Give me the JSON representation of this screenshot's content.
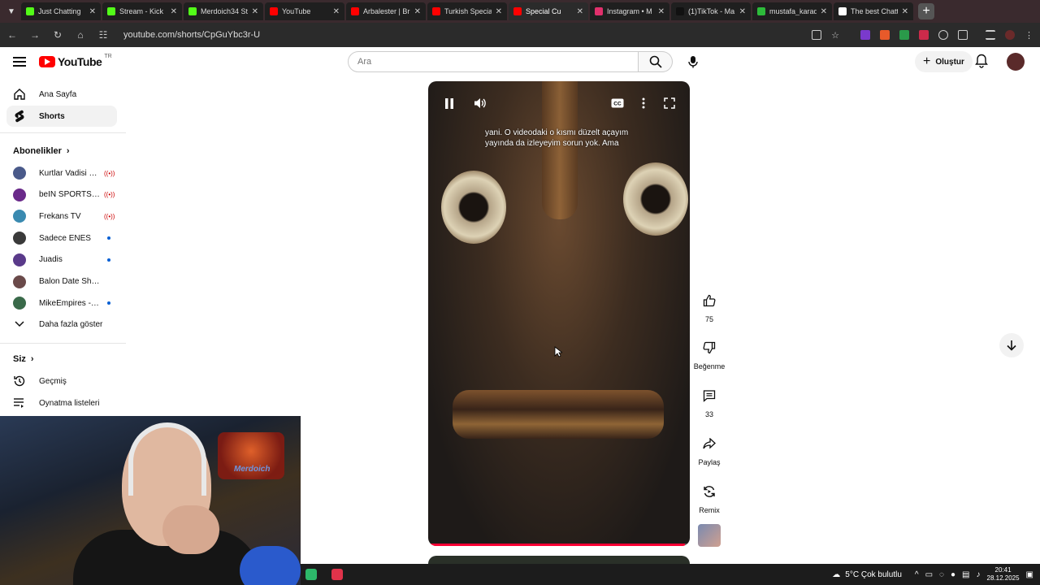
{
  "browser": {
    "tabs": [
      {
        "title": "Just Chatting",
        "color": "#53fc18"
      },
      {
        "title": "Stream - Kick",
        "color": "#53fc18"
      },
      {
        "title": "Merdoich34 St",
        "color": "#53fc18"
      },
      {
        "title": "YouTube",
        "color": "#ff0000"
      },
      {
        "title": "Arbalester | Br",
        "color": "#ff0000"
      },
      {
        "title": "Turkish Special",
        "color": "#ff0000"
      },
      {
        "title": "Special Cu",
        "color": "#ff0000",
        "active": true
      },
      {
        "title": "Instagram • M",
        "color": "#e1306c"
      },
      {
        "title": "(1)TikTok - Ma",
        "color": "#111111"
      },
      {
        "title": "mustafa_karad",
        "color": "#2dbb3a"
      },
      {
        "title": "The best Chatt",
        "color": "#ffffff"
      }
    ],
    "url": "youtube.com/shorts/CpGuYbc3r-U"
  },
  "header": {
    "logo_text": "YouTube",
    "country": "TR",
    "search_placeholder": "Ara",
    "create_label": "Oluştur"
  },
  "sidebar": {
    "main": [
      {
        "label": "Ana Sayfa"
      },
      {
        "label": "Shorts"
      }
    ],
    "subscriptions_heading": "Abonelikler",
    "channels": [
      {
        "name": "Kurtlar Vadisi Pu...",
        "status": "live",
        "color": "#4a5a8a"
      },
      {
        "name": "beIN SPORTS Tü...",
        "status": "live",
        "color": "#6a2a8a"
      },
      {
        "name": "Frekans TV",
        "status": "live",
        "color": "#3a8ab0"
      },
      {
        "name": "Sadece ENES",
        "status": "new",
        "color": "#3a3a3a"
      },
      {
        "name": "Juadis",
        "status": "new",
        "color": "#5a3a8a"
      },
      {
        "name": "Balon Date Show",
        "status": "none",
        "color": "#6a4a4a"
      },
      {
        "name": "MikeEmpires - A...",
        "status": "new",
        "color": "#3a6a4a"
      }
    ],
    "show_more": "Daha fazla göster",
    "you_heading": "Siz",
    "you_items": [
      {
        "label": "Geçmiş"
      },
      {
        "label": "Oynatma listeleri"
      }
    ]
  },
  "webcam": {
    "sign_text": "Merdoich"
  },
  "player": {
    "caption": "yani. O videodaki o kısmı düzelt açayım yayında da izleyeyim sorun yok. Ama",
    "progress": 0.98
  },
  "actions": {
    "like_count": "75",
    "dislike_label": "Beğenme",
    "comment_count": "33",
    "share_label": "Paylaş",
    "remix_label": "Remix"
  },
  "taskbar": {
    "weather": "5°C  Çok bulutlu",
    "time": "20:41",
    "date": "28.12.2025"
  }
}
